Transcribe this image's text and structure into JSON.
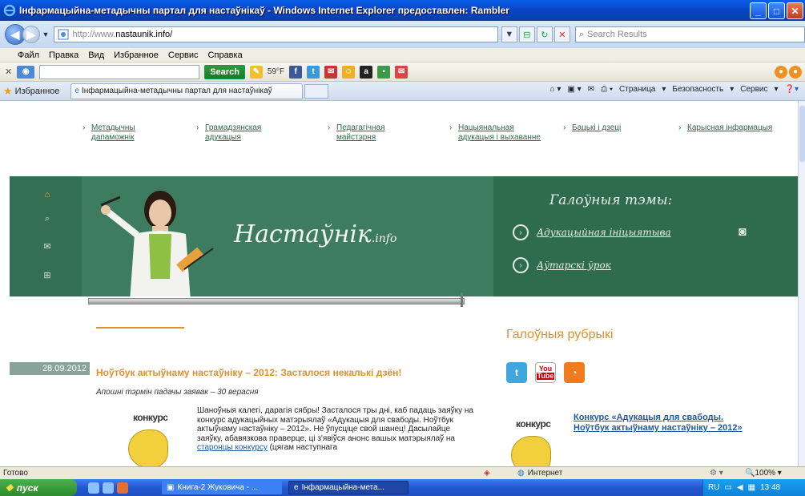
{
  "window": {
    "title": "Інфармацыйна-метадычны партал для настаўнікаў - Windows Internet Explorer предоставлен: Rambler"
  },
  "address": {
    "url_prefix": "http://www.",
    "url_domain": "nastaunik.info/",
    "search_placeholder": "Search Results"
  },
  "menu": [
    "Файл",
    "Правка",
    "Вид",
    "Избранное",
    "Сервис",
    "Справка"
  ],
  "toolbar": {
    "search_label": "Search",
    "temp": "59°F"
  },
  "favorites": {
    "label": "Избранное",
    "tab_title": "Інфармацыйна-метадычны партал для настаўнікаў",
    "commands": [
      "Страница",
      "Безопасность",
      "Сервис"
    ]
  },
  "page": {
    "topnav": [
      "Метадычны дапаможнік",
      "Грамадзянская адукацыя",
      "Педагагічная майстэрня",
      "Нацыянальная адукацыя і выхаванне",
      "Бацькі і дзеці",
      "Карысная інфармацыя"
    ],
    "logo_main": "Настаўнік",
    "logo_suffix": ".info",
    "themes_title": "Галоўныя тэмы:",
    "theme_links": [
      "Адукацыйная ініцыятыва",
      "Аўтарскі ўрок"
    ],
    "rubrics_title": "Галоўныя рубрыкі",
    "news": {
      "date": "28.09.2012",
      "title": "Ноўтбук актыўнаму настаўніку – 2012: Засталося некалькі дзён!",
      "subtitle": "Апошні тэрмін падачы заявак – 30 верасня",
      "body_before": "Шаноўныя калегі, дарагія сябры! Засталося тры дні, каб падаць заяўку на конкурс адукацыйных матэрыялаў «Адукацыя для свабоды. Ноўтбук актыўнаму настаўніку – 2012». Не ўпусціце свой шанец! Дасылайце заяўку, абавязкова праверце, ці з'явіўся анонс вашых матэрыялаў на ",
      "body_link": "старонцы конкурсу",
      "body_after": " (цягам наступнага",
      "badge": "конкурс"
    },
    "side_link": "Конкурс «Адукацыя для свабоды. Ноўтбук актыўнаму настаўніку – 2012»",
    "social": [
      "twitter",
      "YouTube",
      "rss"
    ]
  },
  "status": {
    "left": "Готово",
    "zone": "Интернет",
    "zoom": "100%"
  },
  "taskbar": {
    "start": "пуск",
    "tasks": [
      "Книга-2 Жуковича - ...",
      "Інфармацыйна-мета..."
    ],
    "lang": "RU",
    "clock": "13:48"
  },
  "colors": {
    "accent_orange": "#e3902a",
    "banner_green": "#3d7c5e",
    "link_green": "#2a6a45",
    "link_blue": "#1f5aa0"
  }
}
